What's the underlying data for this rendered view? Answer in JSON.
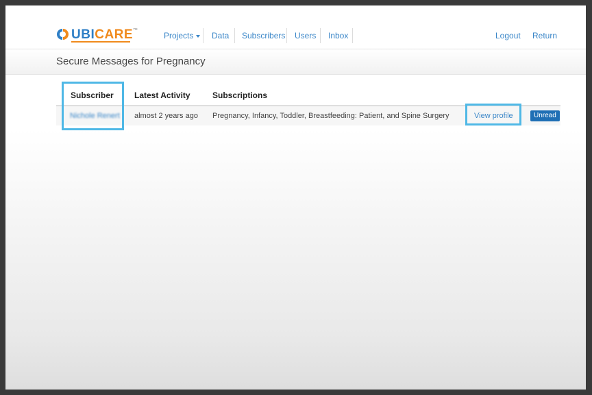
{
  "brand": {
    "name_part1": "UBI",
    "name_part2": "CARE",
    "trademark": "™",
    "colors": {
      "blue": "#2f7fc6",
      "orange": "#f08a1c"
    }
  },
  "nav": {
    "projects": "Projects",
    "data": "Data",
    "subscribers": "Subscribers",
    "users": "Users",
    "inbox": "Inbox",
    "logout": "Logout",
    "return": "Return"
  },
  "page": {
    "title": "Secure Messages for Pregnancy"
  },
  "table": {
    "headers": {
      "subscriber": "Subscriber",
      "latest_activity": "Latest Activity",
      "subscriptions": "Subscriptions"
    },
    "rows": [
      {
        "subscriber": "Nichole Renert",
        "latest_activity": "almost 2 years ago",
        "subscriptions": "Pregnancy, Infancy, Toddler, Breastfeeding: Patient, and Spine Surgery",
        "action": "View profile",
        "status": "Unread"
      }
    ]
  },
  "colors": {
    "link": "#3a86c8",
    "highlight": "#4fb8e6",
    "badge": "#1f6fb5"
  }
}
